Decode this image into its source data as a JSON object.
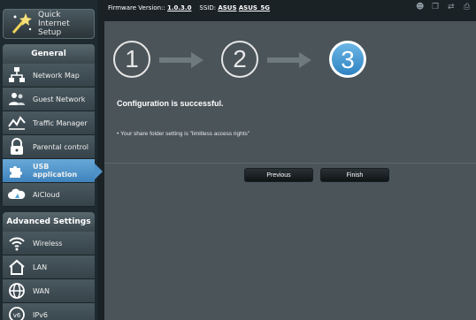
{
  "sidebar": {
    "qis_label_line1": "Quick Internet",
    "qis_label_line2": "Setup",
    "general_title": "General",
    "general_items": [
      {
        "label": "Network Map",
        "icon": "network-map-icon"
      },
      {
        "label": "Guest Network",
        "icon": "guest-network-icon"
      },
      {
        "label": "Traffic Manager",
        "icon": "traffic-manager-icon"
      },
      {
        "label": "Parental control",
        "icon": "parental-control-icon"
      },
      {
        "label": "USB application",
        "icon": "usb-application-icon",
        "active": true
      },
      {
        "label": "AiCloud",
        "icon": "aicloud-icon"
      }
    ],
    "advanced_title": "Advanced Settings",
    "advanced_items": [
      {
        "label": "Wireless",
        "icon": "wireless-icon"
      },
      {
        "label": "LAN",
        "icon": "lan-icon"
      },
      {
        "label": "WAN",
        "icon": "wan-icon"
      },
      {
        "label": "IPv6",
        "icon": "ipv6-icon"
      }
    ]
  },
  "topbar": {
    "firmware_label": "Firmware Version::",
    "firmware_value": "1.0.3.0",
    "ssid_label": "SSID:",
    "ssid_1": "ASUS",
    "ssid_2": "ASUS_5G",
    "status_icons": [
      "user-icon",
      "copy-icon",
      "usb-icon",
      "printer-icon"
    ]
  },
  "wizard": {
    "steps": [
      "1",
      "2",
      "3"
    ],
    "current_step": 3,
    "headline": "Configuration is successful.",
    "bullet": "Your share folder setting is \"limitless access rights\"",
    "previous_label": "Previous",
    "finish_label": "Finish"
  },
  "colors": {
    "accent": "#3f83bd",
    "panel": "#4a5459",
    "sidebar": "#1e2a30"
  }
}
